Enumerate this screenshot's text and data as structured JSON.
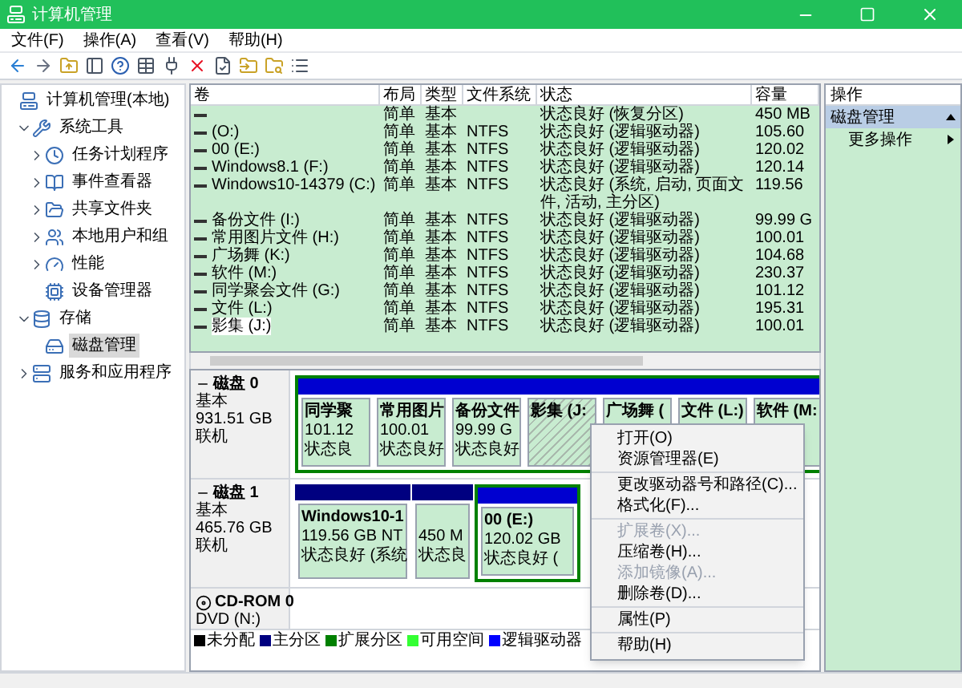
{
  "window": {
    "title": "计算机管理"
  },
  "menu": [
    "文件(F)",
    "操作(A)",
    "查看(V)",
    "帮助(H)"
  ],
  "tree": [
    {
      "label": "计算机管理(本地)",
      "selected": false,
      "children": [
        {
          "label": "系统工具",
          "expanded": true,
          "selected": false,
          "children": [
            {
              "label": "任务计划程序",
              "expanded": false,
              "selected": false
            },
            {
              "label": "事件查看器",
              "expanded": false,
              "selected": false
            },
            {
              "label": "共享文件夹",
              "expanded": false,
              "selected": false
            },
            {
              "label": "本地用户和组",
              "expanded": false,
              "selected": false
            },
            {
              "label": "性能",
              "expanded": false,
              "selected": false
            },
            {
              "label": "设备管理器",
              "selected": false
            }
          ]
        },
        {
          "label": "存储",
          "expanded": true,
          "selected": false,
          "children": [
            {
              "label": "磁盘管理",
              "selected": true
            }
          ]
        },
        {
          "label": "服务和应用程序",
          "expanded": false,
          "selected": false
        }
      ]
    }
  ],
  "table": {
    "columns": [
      "卷",
      "布局",
      "类型",
      "文件系统",
      "状态",
      "容量"
    ],
    "rows": [
      {
        "layout": "简单",
        "type": "基本",
        "status": "状态良好 (恢复分区)",
        "capacity": "450 MB",
        "selected": false
      },
      {
        "volume": "(O:)",
        "layout": "简单",
        "type": "基本",
        "fs": "NTFS",
        "status": "状态良好 (逻辑驱动器)",
        "capacity": "105.60",
        "selected": false
      },
      {
        "volume": "00 (E:)",
        "layout": "简单",
        "type": "基本",
        "fs": "NTFS",
        "status": "状态良好 (逻辑驱动器)",
        "capacity": "120.02",
        "selected": false
      },
      {
        "volume": "Windows8.1 (F:)",
        "layout": "简单",
        "type": "基本",
        "fs": "NTFS",
        "status": "状态良好 (逻辑驱动器)",
        "capacity": "120.14",
        "selected": false
      },
      {
        "volume": "Windows10-14379 (C:)",
        "layout": "简单",
        "type": "基本",
        "fs": "NTFS",
        "status": "状态良好 (系统, 启动, 页面文件, 活动, 主分区)",
        "capacity": "119.56",
        "selected": false
      },
      {
        "volume": "备份文件 (I:)",
        "layout": "简单",
        "type": "基本",
        "fs": "NTFS",
        "status": "状态良好 (逻辑驱动器)",
        "capacity": "99.99 G",
        "selected": false
      },
      {
        "volume": "常用图片文件 (H:)",
        "layout": "简单",
        "type": "基本",
        "fs": "NTFS",
        "status": "状态良好 (逻辑驱动器)",
        "capacity": "100.01",
        "selected": false
      },
      {
        "volume": "广场舞 (K:)",
        "layout": "简单",
        "type": "基本",
        "fs": "NTFS",
        "status": "状态良好 (逻辑驱动器)",
        "capacity": "104.68",
        "selected": false
      },
      {
        "volume": "软件 (M:)",
        "layout": "简单",
        "type": "基本",
        "fs": "NTFS",
        "status": "状态良好 (逻辑驱动器)",
        "capacity": "230.37",
        "selected": false
      },
      {
        "volume": "同学聚会文件 (G:)",
        "layout": "简单",
        "type": "基本",
        "fs": "NTFS",
        "status": "状态良好 (逻辑驱动器)",
        "capacity": "101.12",
        "selected": false
      },
      {
        "volume": "文件 (L:)",
        "layout": "简单",
        "type": "基本",
        "fs": "NTFS",
        "status": "状态良好 (逻辑驱动器)",
        "capacity": "195.31",
        "selected": false
      },
      {
        "volume": "影集 (J:)",
        "layout": "简单",
        "type": "基本",
        "fs": "NTFS",
        "status": "状态良好 (逻辑驱动器)",
        "capacity": "100.01",
        "selected": true
      }
    ]
  },
  "disks": [
    {
      "name": "磁盘 0",
      "kind": "disk",
      "type": "基本",
      "size": "931.51 GB",
      "state": "联机",
      "partitions": [
        {
          "name": "同学聚",
          "size": "101.12",
          "status": "状态良",
          "kind": "logical",
          "selected": false
        },
        {
          "name": "常用图片",
          "size": "100.01",
          "status": "状态良好",
          "kind": "logical",
          "selected": false
        },
        {
          "name": "备份文件",
          "size": "99.99 G",
          "status": "状态良好",
          "kind": "logical",
          "selected": false
        },
        {
          "name": "影集 (J:",
          "kind": "logical",
          "selected": true
        },
        {
          "name": "广场舞 (",
          "kind": "logical",
          "selected": false
        },
        {
          "name": "文件 (L:)",
          "kind": "logical",
          "selected": false
        },
        {
          "name": "软件 (M:",
          "kind": "logical",
          "selected": false
        }
      ]
    },
    {
      "name": "磁盘 1",
      "kind": "disk",
      "type": "基本",
      "size": "465.76 GB",
      "state": "联机",
      "partitions": [
        {
          "name": "Windows10-1",
          "size": "119.56 GB NT",
          "status": "状态良好 (系统",
          "kind": "primary",
          "selected": false
        },
        {
          "size": "450 M",
          "status": "状态良",
          "kind": "primary",
          "selected": false
        },
        {
          "name": "00 (E:)",
          "size": "120.02 GB",
          "status": "状态良好 (",
          "kind": "logical",
          "selected": false
        }
      ]
    },
    {
      "name": "CD-ROM 0",
      "kind": "cdrom",
      "type": "DVD (N:)"
    }
  ],
  "legend": [
    {
      "label": "未分配",
      "color": "#000000"
    },
    {
      "label": "主分区",
      "color": "#000080"
    },
    {
      "label": "扩展分区",
      "color": "#008000"
    },
    {
      "label": "可用空间",
      "color": "#33ff33"
    },
    {
      "label": "逻辑驱动器",
      "color": "#0000ff"
    }
  ],
  "context_menu": [
    [
      {
        "label": "打开(O)",
        "disabled": false
      },
      {
        "label": "资源管理器(E)",
        "disabled": false
      }
    ],
    [
      {
        "label": "更改驱动器号和路径(C)...",
        "disabled": false
      },
      {
        "label": "格式化(F)...",
        "disabled": false
      }
    ],
    [
      {
        "label": "扩展卷(X)...",
        "disabled": true
      },
      {
        "label": "压缩卷(H)...",
        "disabled": false
      },
      {
        "label": "添加镜像(A)...",
        "disabled": true
      },
      {
        "label": "删除卷(D)...",
        "disabled": false
      }
    ],
    [
      {
        "label": "属性(P)",
        "disabled": false
      }
    ],
    [
      {
        "label": "帮助(H)",
        "disabled": false
      }
    ]
  ],
  "actions": {
    "title": "操作",
    "section": "磁盘管理",
    "items": [
      "更多操作"
    ]
  }
}
